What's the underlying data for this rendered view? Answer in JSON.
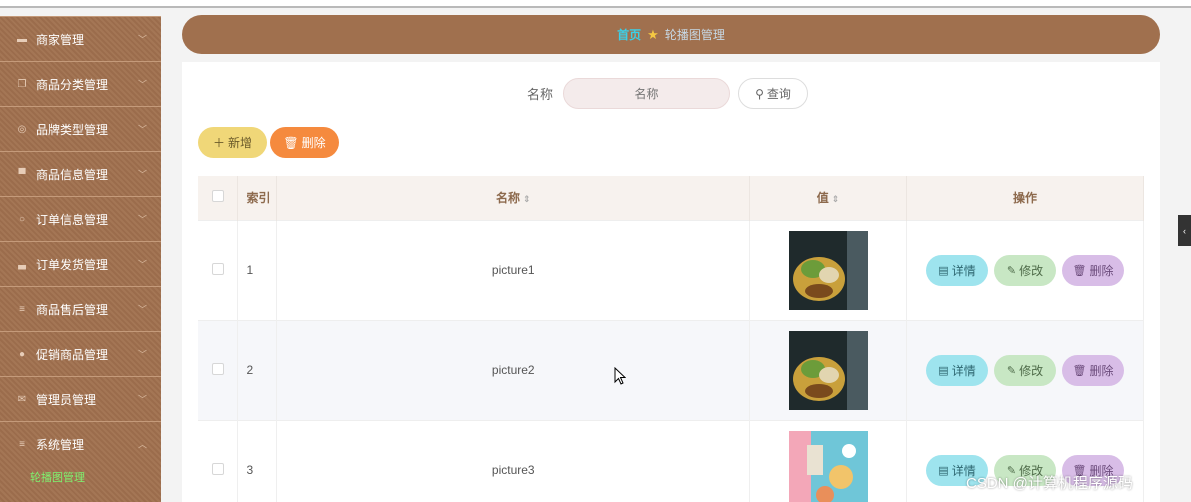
{
  "sidebar": {
    "items": [
      {
        "label": "商家管理",
        "icon": "store-icon"
      },
      {
        "label": "商品分类管理",
        "icon": "copy-icon"
      },
      {
        "label": "品牌类型管理",
        "icon": "compass-icon"
      },
      {
        "label": "商品信息管理",
        "icon": "monitor-icon"
      },
      {
        "label": "订单信息管理",
        "icon": "loading-icon"
      },
      {
        "label": "订单发货管理",
        "icon": "truck-icon"
      },
      {
        "label": "商品售后管理",
        "icon": "menu-icon"
      },
      {
        "label": "促销商品管理",
        "icon": "user-icon"
      },
      {
        "label": "管理员管理",
        "icon": "mail-icon"
      },
      {
        "label": "系统管理",
        "icon": "menu-icon"
      }
    ],
    "submenu": {
      "label": "轮播图管理"
    }
  },
  "breadcrumb": {
    "home": "首页",
    "current": "轮播图管理"
  },
  "search": {
    "label": "名称",
    "placeholder": "名称",
    "button": "查询"
  },
  "actions": {
    "add": "新增",
    "delete": "删除"
  },
  "table": {
    "headers": {
      "index": "索引",
      "name": "名称",
      "value": "值",
      "operation": "操作"
    },
    "rows": [
      {
        "index": "1",
        "name": "picture1"
      },
      {
        "index": "2",
        "name": "picture2"
      },
      {
        "index": "3",
        "name": "picture3"
      }
    ],
    "row_actions": {
      "detail": "详情",
      "edit": "修改",
      "delete": "删除"
    }
  },
  "watermark": "CSDN @计算机程序源码",
  "colors": {
    "sidebar": "#a0704e",
    "breadcrumb_home": "#3ad0e8",
    "add_button": "#f0d778",
    "delete_button": "#f58a3e",
    "detail": "#9ee4ee",
    "edit": "#c8e7c4",
    "row_delete": "#d8bde7"
  }
}
